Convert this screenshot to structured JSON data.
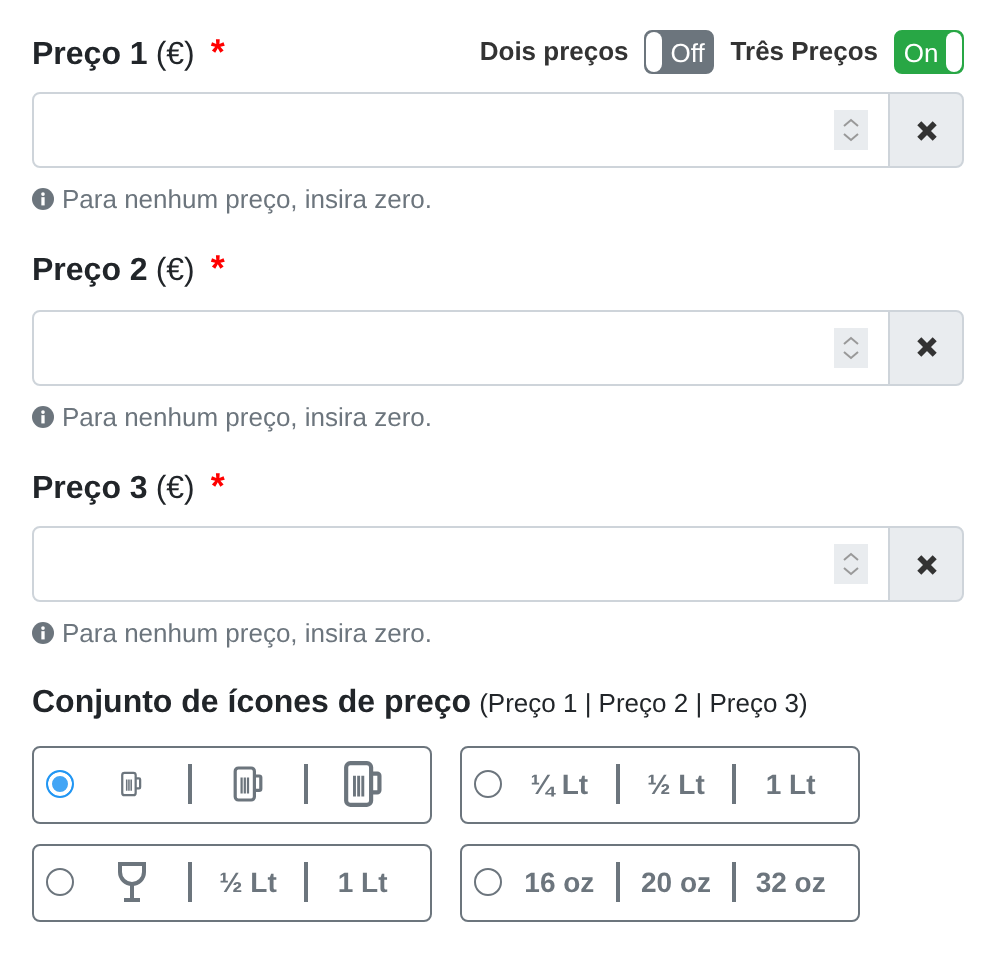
{
  "toggles": [
    {
      "label": "Dois preços",
      "on": false,
      "text": "Off"
    },
    {
      "label": "Três Preços",
      "on": true,
      "text": "On"
    }
  ],
  "prices": [
    {
      "label": "Preço 1",
      "unit": "(€)",
      "required": "*",
      "hint": "Para nenhum preço, insira zero."
    },
    {
      "label": "Preço 2",
      "unit": "(€)",
      "required": "*",
      "hint": "Para nenhum preço, insira zero."
    },
    {
      "label": "Preço 3",
      "unit": "(€)",
      "required": "*",
      "hint": "Para nenhum preço, insira zero."
    }
  ],
  "icon_sets": {
    "title": "Conjunto de ícones de preço",
    "subtitle": "(Preço 1 | Preço 2 | Preço 3)",
    "options": [
      {
        "selected": true,
        "items": [
          {
            "kind": "mugsmall"
          },
          {
            "kind": "mugmedium"
          },
          {
            "kind": "muglarge"
          }
        ]
      },
      {
        "selected": false,
        "items": [
          {
            "kind": "text",
            "text": "¼ Lt"
          },
          {
            "kind": "text",
            "text": "½ Lt"
          },
          {
            "kind": "text",
            "text": "1 Lt"
          }
        ]
      },
      {
        "selected": false,
        "items": [
          {
            "kind": "glass"
          },
          {
            "kind": "text",
            "text": "½ Lt"
          },
          {
            "kind": "text",
            "text": "1 Lt"
          }
        ]
      },
      {
        "selected": false,
        "items": [
          {
            "kind": "text",
            "text": "16 oz"
          },
          {
            "kind": "text",
            "text": "20 oz"
          },
          {
            "kind": "text",
            "text": "32 oz"
          }
        ]
      }
    ]
  }
}
